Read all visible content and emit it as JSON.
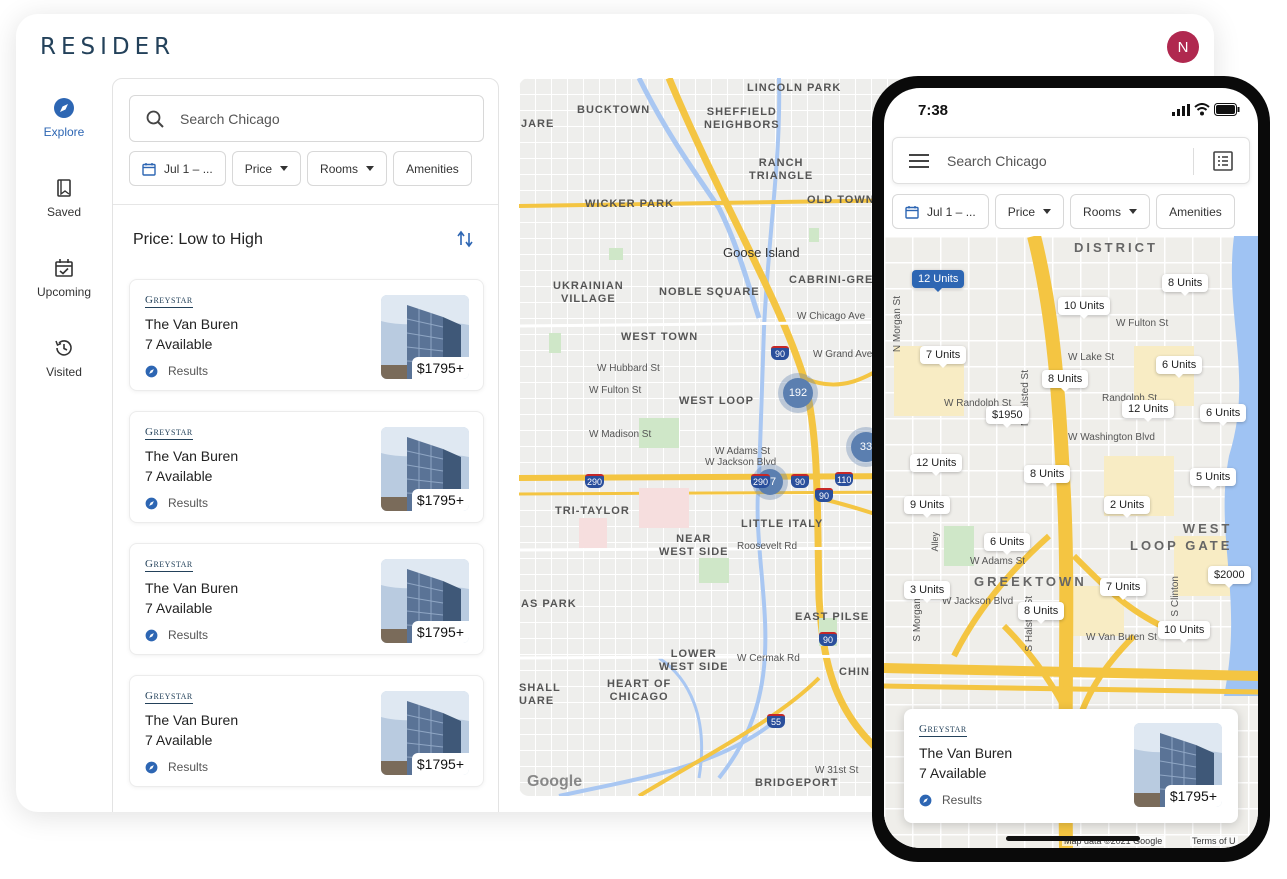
{
  "app": {
    "logo": "RESIDER",
    "avatar_initial": "N",
    "brand_color": "#2d66b3",
    "avatar_color": "#b0284f"
  },
  "nav": [
    {
      "label": "Explore",
      "icon": "compass-icon",
      "active": true
    },
    {
      "label": "Saved",
      "icon": "bookmark-icon"
    },
    {
      "label": "Upcoming",
      "icon": "calendar-check-icon"
    },
    {
      "label": "Visited",
      "icon": "history-icon"
    }
  ],
  "search": {
    "placeholder": "Search Chicago"
  },
  "filters": {
    "date": "Jul 1 – ...",
    "price": "Price",
    "rooms": "Rooms",
    "amenities": "Amenities"
  },
  "sort": {
    "label": "Price: Low to High"
  },
  "listings": [
    {
      "brand": "Greystar",
      "title": "The Van Buren",
      "available": "7 Available",
      "results": "Results",
      "price": "$1795+"
    },
    {
      "brand": "Greystar",
      "title": "The Van Buren",
      "available": "7 Available",
      "results": "Results",
      "price": "$1795+"
    },
    {
      "brand": "Greystar",
      "title": "The Van Buren",
      "available": "7 Available",
      "results": "Results",
      "price": "$1795+"
    },
    {
      "brand": "Greystar",
      "title": "The Van Buren",
      "available": "7 Available",
      "results": "Results",
      "price": "$1795+"
    }
  ],
  "desktop_map": {
    "labels": {
      "lincoln_park": "LINCOLN PARK",
      "bucktown": "BUCKTOWN",
      "sheffield": "SHEFFIELD\nNEIGHBORS",
      "ranch": "RANCH\nTRIANGLE",
      "wicker": "WICKER PARK",
      "oldtown": "OLD TOWN",
      "goose": "Goose Island",
      "ukrainian": "UKRAINIAN\nVILLAGE",
      "noble": "NOBLE SQUARE",
      "cabrini": "CABRINI-GRE",
      "westtown": "WEST TOWN",
      "westloop": "WEST LOOP",
      "tritaylor": "TRI-TAYLOR",
      "littleitaly": "LITTLE ITALY",
      "nearwest": "NEAR\nWEST SIDE",
      "aspark": "AS PARK",
      "eastpilsen": "EAST PILSE",
      "lowerwest": "LOWER\nWEST SIDE",
      "heart": "HEART OF\nCHICAGO",
      "shall": "SHALL\nUARE",
      "bridgeport": "BRIDGEPORT",
      "chin": "CHIN",
      "jare": "JARE",
      "wchicago": "W Chicago Ave",
      "wgrand": "W Grand Ave",
      "whubbard": "W Hubbard St",
      "wfulton": "W Fulton St",
      "wmadison": "W Madison St",
      "wadams": "W Adams St",
      "wjackson": "W Jackson Blvd",
      "roosevelt": "Roosevelt Rd",
      "wcermak": "W Cermak Rd",
      "w31st": "W 31st St",
      "google": "Google"
    },
    "clusters": [
      "192",
      "33",
      "17"
    ],
    "shields": [
      "90",
      "290",
      "90",
      "110",
      "90",
      "290",
      "55",
      "90"
    ]
  },
  "phone": {
    "time": "7:38",
    "search_placeholder": "Search Chicago",
    "filters": {
      "date": "Jul 1 – ...",
      "price": "Price",
      "rooms": "Rooms",
      "amenities": "Amenities"
    },
    "map_labels": {
      "district": "DISTRICT",
      "westloop": "WEST\nLOOP GATE",
      "greektown": "GREEKTOWN",
      "wfulton": "W Fulton St",
      "wlake": "W Lake St",
      "wrandolph": "W Randolph St",
      "wrandolph2": "Randolph St",
      "wwashington": "W Washington Blvd",
      "wadams": "W Adams St",
      "wjackson": "W Jackson Blvd",
      "wvanburen": "W Van Buren St",
      "morgan": "N Morgan St",
      "morgan2": "S Morgan St",
      "halsted": "N Halsted St",
      "halsted2": "S Halsted St",
      "clinton": "S Clinton",
      "alley": "Alley",
      "mapdata": "Map data ©2021 Google",
      "terms": "Terms of U"
    },
    "pins": [
      "12 Units",
      "8 Units",
      "10 Units",
      "7 Units",
      "8 Units",
      "6 Units",
      "$1950",
      "12 Units",
      "6 Units",
      "12 Units",
      "8 Units",
      "5 Units",
      "9 Units",
      "2 Units",
      "6 Units",
      "$2000",
      "3 Units",
      "7 Units",
      "8 Units",
      "10 Units"
    ],
    "card": {
      "brand": "Greystar",
      "title": "The Van Buren",
      "available": "7 Available",
      "results": "Results",
      "price": "$1795+"
    }
  }
}
